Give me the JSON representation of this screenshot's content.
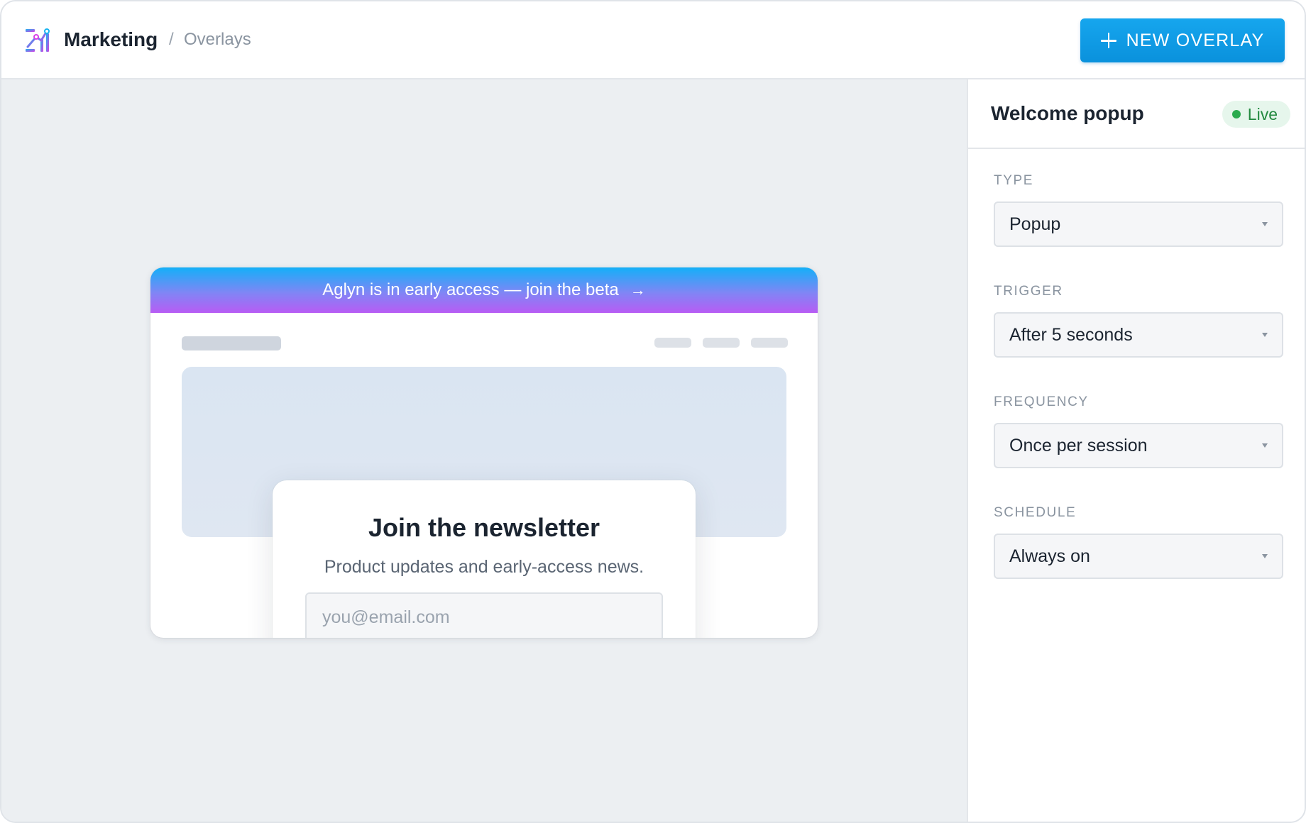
{
  "header": {
    "app_name": "Marketing",
    "separator": "/",
    "page": "Overlays",
    "new_button_label": "NEW OVERLAY"
  },
  "preview": {
    "banner_text": "Aglyn is in early access — join the beta",
    "banner_arrow": "→",
    "popup": {
      "title": "Join the newsletter",
      "subtitle": "Product updates and early-access news.",
      "email_placeholder": "you@email.com"
    }
  },
  "sidebar": {
    "title": "Welcome popup",
    "status": "Live",
    "fields": {
      "type": {
        "label": "TYPE",
        "value": "Popup"
      },
      "trigger": {
        "label": "TRIGGER",
        "value": "After 5 seconds"
      },
      "frequency": {
        "label": "FREQUENCY",
        "value": "Once per session"
      },
      "schedule": {
        "label": "SCHEDULE",
        "value": "Always on"
      }
    }
  },
  "colors": {
    "accent": "#0a91dc",
    "status_live": "#2bab4e",
    "banner_gradient": [
      "#13b0f8",
      "#b85cf4"
    ]
  },
  "icons": {
    "logo": "bar-chart-logo-icon",
    "new_button": "plus-icon",
    "banner": "arrow-right-icon",
    "select": "caret-down-icon"
  }
}
